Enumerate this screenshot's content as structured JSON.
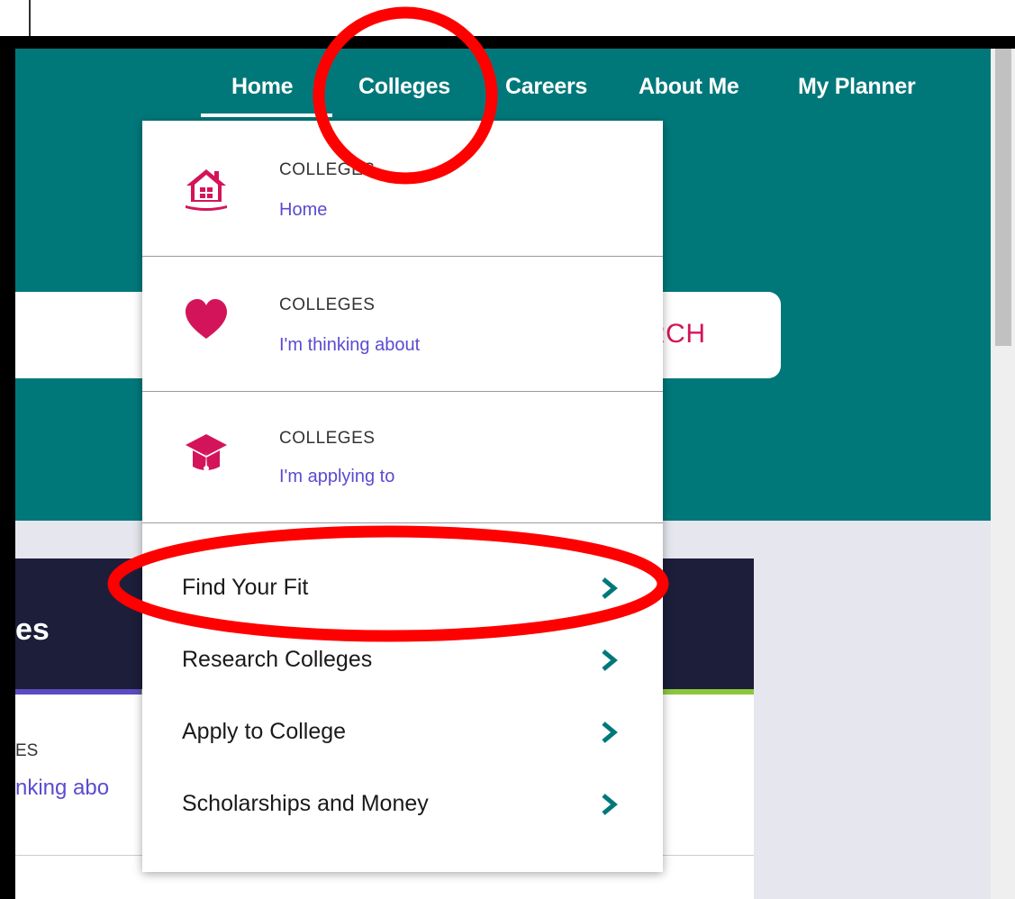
{
  "nav": {
    "items": [
      {
        "label": "Home"
      },
      {
        "label": "Colleges"
      },
      {
        "label": "Careers"
      },
      {
        "label": "About Me"
      },
      {
        "label": "My Planner"
      }
    ],
    "active": "Home"
  },
  "search": {
    "button_label": "RCH"
  },
  "background_panel": {
    "title": "es",
    "card_category": "ES",
    "card_link": "nking abo"
  },
  "dropdown": {
    "sections": [
      {
        "category": "COLLEGES",
        "link": "Home",
        "icon": "house-icon"
      },
      {
        "category": "COLLEGES",
        "link": "I'm thinking about",
        "icon": "heart-icon"
      },
      {
        "category": "COLLEGES",
        "link": "I'm applying to",
        "icon": "graduation-cap-icon"
      }
    ],
    "items": [
      {
        "label": "Find Your Fit"
      },
      {
        "label": "Research Colleges"
      },
      {
        "label": "Apply to College"
      },
      {
        "label": "Scholarships and Money"
      }
    ]
  },
  "colors": {
    "header_teal": "#00787a",
    "accent_pink": "#d4145a",
    "link_purple": "#5a4bd1",
    "chevron_teal": "#00787a",
    "annotation_red": "#ff0000"
  }
}
